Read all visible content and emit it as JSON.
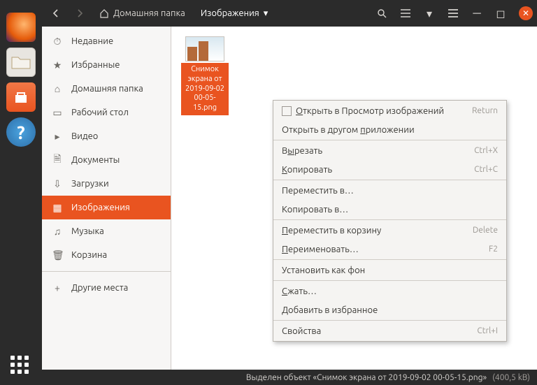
{
  "titlebar": {
    "home": "Домашняя папка",
    "current": "Изображения"
  },
  "sidebar": {
    "items": [
      {
        "icon": "⏱",
        "label": "Недавние"
      },
      {
        "icon": "★",
        "label": "Избранные"
      },
      {
        "icon": "⌂",
        "label": "Домашняя папка"
      },
      {
        "icon": "▭",
        "label": "Рабочий стол"
      },
      {
        "icon": "▸",
        "label": "Видео"
      },
      {
        "icon": "🗎",
        "label": "Документы"
      },
      {
        "icon": "⇩",
        "label": "Загрузки"
      },
      {
        "icon": "▦",
        "label": "Изображения"
      },
      {
        "icon": "♫",
        "label": "Музыка"
      },
      {
        "icon": "🗑",
        "label": "Корзина"
      }
    ],
    "other": {
      "icon": "+",
      "label": "Другие места"
    },
    "active_index": 7
  },
  "file": {
    "label": "Снимок экрана от 2019-09-02 00-05-15.png"
  },
  "context_menu": {
    "items": [
      {
        "label": "Открыть в Просмотр изображений",
        "accel": "Return",
        "icon": true,
        "ukey": "О"
      },
      {
        "label": "Открыть в другом приложении",
        "ukey": "п"
      },
      {
        "sep": true
      },
      {
        "label": "Вырезать",
        "accel": "Ctrl+X",
        "ukey": "ы"
      },
      {
        "label": "Копировать",
        "accel": "Ctrl+C",
        "ukey": "К"
      },
      {
        "sep": true
      },
      {
        "label": "Переместить в…"
      },
      {
        "label": "Копировать в…"
      },
      {
        "sep": true
      },
      {
        "label": "Переместить в корзину",
        "accel": "Delete",
        "ukey": "П"
      },
      {
        "label": "Переименовать…",
        "accel": "F2",
        "ukey": "П"
      },
      {
        "sep": true
      },
      {
        "label": "Установить как фон"
      },
      {
        "sep": true
      },
      {
        "label": "Сжать…",
        "ukey": "С"
      },
      {
        "label": "Добавить в избранное"
      },
      {
        "sep": true
      },
      {
        "label": "Свойства",
        "accel": "Ctrl+I"
      }
    ]
  },
  "statusbar": {
    "text": "Выделен объект «Снимок экрана от 2019-09-02 00-05-15.png»",
    "size": "(400,5 kB)"
  },
  "dock": {
    "help": "?"
  }
}
